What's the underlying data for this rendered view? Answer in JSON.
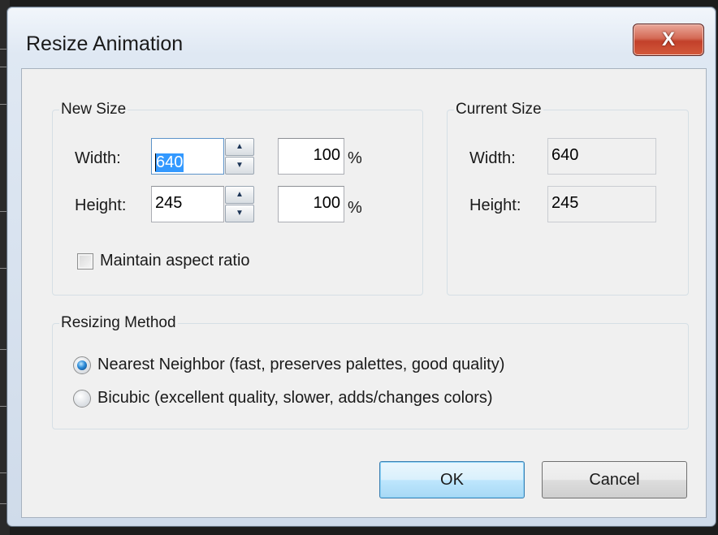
{
  "window": {
    "title": "Resize Animation",
    "close_glyph": "X",
    "close_icon": "close-icon"
  },
  "new_size": {
    "legend": "New Size",
    "width_label": "Width:",
    "width_value": "640",
    "width_percent": "100",
    "height_label": "Height:",
    "height_value": "245",
    "height_percent": "100",
    "percent_sign": "%",
    "spin_up_glyph": "▲",
    "spin_down_glyph": "▼",
    "maintain_aspect_label": "Maintain aspect ratio",
    "maintain_aspect_checked": false
  },
  "current_size": {
    "legend": "Current Size",
    "width_label": "Width:",
    "width_value": "640",
    "height_label": "Height:",
    "height_value": "245"
  },
  "resizing_method": {
    "legend": "Resizing Method",
    "options": [
      {
        "label": "Nearest Neighbor (fast, preserves palettes, good quality)",
        "selected": true
      },
      {
        "label": "Bicubic (excellent quality, slower, adds/changes colors)",
        "selected": false
      }
    ]
  },
  "buttons": {
    "ok": "OK",
    "cancel": "Cancel"
  },
  "colors": {
    "accent_selection": "#3399ff",
    "close_button_red": "#c2402a",
    "default_button_border": "#3c7fb1"
  }
}
